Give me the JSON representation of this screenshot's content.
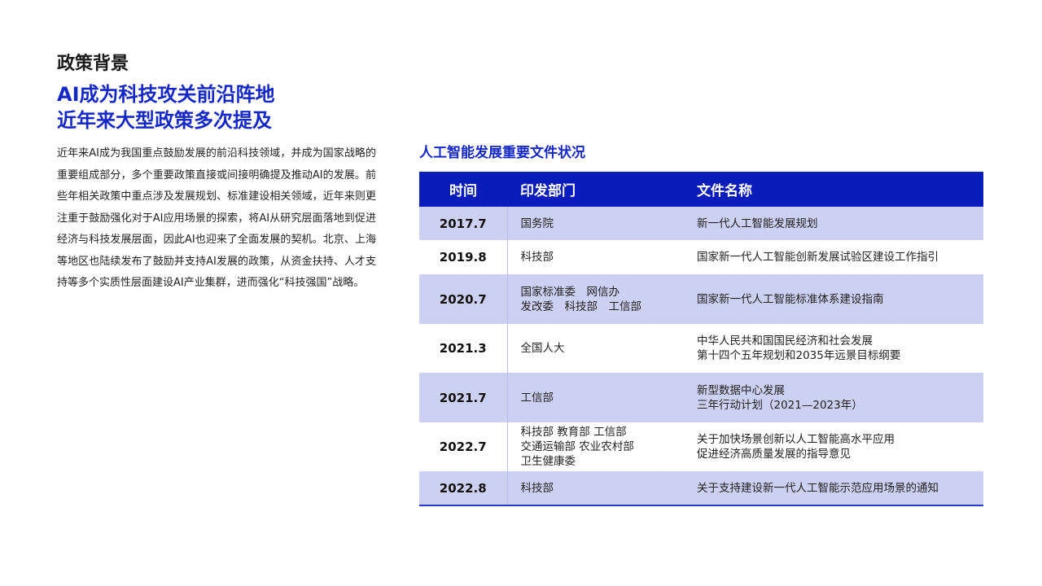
{
  "left": {
    "section_label": "政策背景",
    "headline_lines": [
      "AI成为科技攻关前沿阵地",
      "近年来大型政策多次提及"
    ],
    "body": "近年来AI成为我国重点鼓励发展的前沿科技领域，并成为国家战略的重要组成部分，多个重要政策直接或间接明确提及推动AI的发展。前些年相关政策中重点涉及发展规划、标准建设相关领域，近年来则更注重于鼓励强化对于AI应用场景的探索，将AI从研究层面落地到促进经济与科技发展层面，因此AI也迎来了全面发展的契机。北京、上海等地区也陆续发布了鼓励并支持AI发展的政策，从资金扶持、人才支持等多个实质性层面建设AI产业集群，进而强化“科技强国”战略。"
  },
  "table": {
    "title": "人工智能发展重要文件状况",
    "headers": {
      "time": "时间",
      "dept": "印发部门",
      "doc": "文件名称"
    },
    "rows": [
      {
        "time": "2017.7",
        "dept": [
          "国务院"
        ],
        "doc": [
          "新一代人工智能发展规划"
        ]
      },
      {
        "time": "2019.8",
        "dept": [
          "科技部"
        ],
        "doc": [
          "国家新一代人工智能创新发展试验区建设工作指引"
        ]
      },
      {
        "time": "2020.7",
        "dept": [
          "国家标准委　网信办",
          "发改委　科技部　工信部"
        ],
        "doc": [
          "国家新一代人工智能标准体系建设指南"
        ]
      },
      {
        "time": "2021.3",
        "dept": [
          "全国人大"
        ],
        "doc": [
          "中华人民共和国国民经济和社会发展",
          "第十四个五年规划和2035年远景目标纲要"
        ]
      },
      {
        "time": "2021.7",
        "dept": [
          "工信部"
        ],
        "doc": [
          "新型数据中心发展",
          "三年行动计划（2021—2023年）"
        ]
      },
      {
        "time": "2022.7",
        "dept": [
          "科技部 教育部 工信部",
          "交通运输部 农业农村部",
          "卫生健康委"
        ],
        "doc": [
          "关于加快场景创新以人工智能高水平应用",
          "促进经济高质量发展的指导意见"
        ]
      },
      {
        "time": "2022.8",
        "dept": [
          "科技部"
        ],
        "doc": [
          "关于支持建设新一代人工智能示范应用场景的通知"
        ]
      }
    ]
  },
  "colors": {
    "accent": "#1428c8",
    "header_bg": "#0a1cbc",
    "row_shade": "#ccd0f2"
  }
}
